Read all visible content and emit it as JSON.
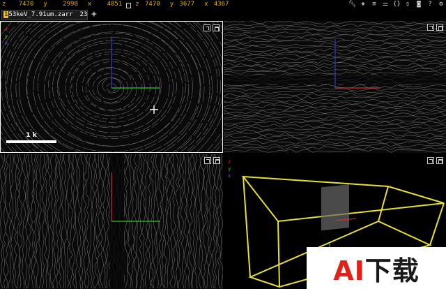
{
  "status_bar": {
    "left": {
      "z_label": "z",
      "z_value": "7470",
      "y_label": "y",
      "y_value": "2998",
      "x_label": "x",
      "x_value": "4851"
    },
    "right": {
      "z_label": "z",
      "z_value": "7470",
      "y_label": "y",
      "y_value": "3677",
      "x_label": "x",
      "x_value": "4367"
    },
    "icons": [
      "wrench-icon",
      "layers-icon",
      "list-icon",
      "sliders-icon",
      "braces-icon",
      "document-icon",
      "camera-icon",
      "help-icon",
      "settings-icon"
    ],
    "accent_color": "#e0a800"
  },
  "layer_bar": {
    "tab_prefix": "1",
    "tab_name": "53keV_7.91um.zarr",
    "tab_number": "23",
    "add_label": "+"
  },
  "panels": {
    "xy": {
      "scale_label": "1 k",
      "axes": [
        "z",
        "y",
        "x"
      ]
    },
    "perspective": {
      "axes": [
        "z",
        "y",
        "x"
      ]
    }
  },
  "watermark": {
    "ai": "AI",
    "cn": "下载"
  }
}
